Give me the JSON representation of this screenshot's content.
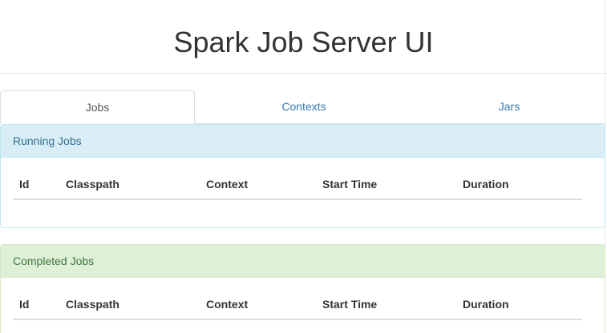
{
  "app": {
    "title": "Spark Job Server UI"
  },
  "tabs": [
    {
      "label": "Jobs",
      "active": true
    },
    {
      "label": "Contexts",
      "active": false
    },
    {
      "label": "Jars",
      "active": false
    }
  ],
  "running_jobs": {
    "heading": "Running Jobs",
    "columns": [
      "Id",
      "Classpath",
      "Context",
      "Start Time",
      "Duration"
    ],
    "rows": []
  },
  "completed_jobs": {
    "heading": "Completed Jobs",
    "columns": [
      "Id",
      "Classpath",
      "Context",
      "Start Time",
      "Duration"
    ],
    "rows": []
  },
  "colors": {
    "link": "#337ab7",
    "info_bg": "#d9edf7",
    "info_text": "#31708f",
    "success_bg": "#dff0d8",
    "success_text": "#3c763d"
  }
}
